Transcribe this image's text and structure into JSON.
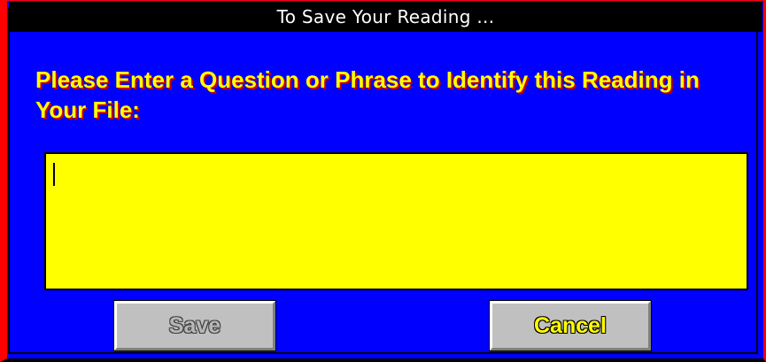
{
  "window": {
    "title": "To Save Your Reading ..."
  },
  "dialog": {
    "prompt": "Please Enter a Question or Phrase to Identify this Reading in Your File:",
    "entry_value": ""
  },
  "buttons": {
    "save_label": "Save",
    "save_enabled": false,
    "cancel_label": "Cancel"
  },
  "colors": {
    "background": "#0000ff",
    "titlebar": "#000000",
    "title_text": "#ffffff",
    "prompt_text": "#ffff00",
    "entry_background": "#ffff00",
    "button_face": "#c0c0c0",
    "frame": "#ff0000"
  }
}
